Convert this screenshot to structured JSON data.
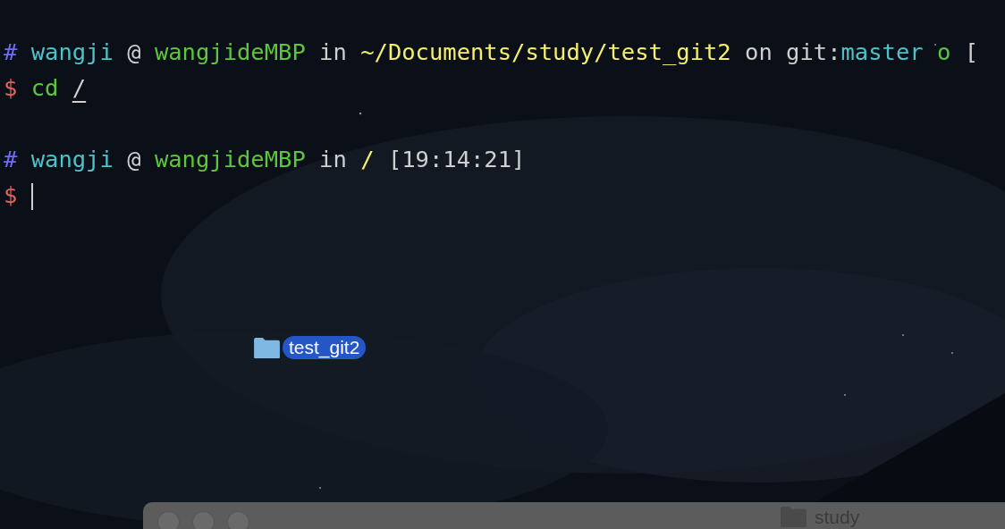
{
  "terminal": {
    "blocks": [
      {
        "prompt": [
          {
            "text": "#",
            "color": "#6f6cff",
            "underlined": false
          },
          {
            "text": "wangji",
            "color": "#4fc1c9",
            "underlined": false
          },
          {
            "text": "@",
            "color": "#cfcfcf",
            "underlined": false
          },
          {
            "text": "wangjideMBP",
            "color": "#5ec63c",
            "underlined": false
          },
          {
            "text": "in",
            "color": "#cfcfcf",
            "underlined": false
          },
          {
            "text": "~/Documents/study/test_git2",
            "color": "#f4ef6c",
            "underlined": false
          },
          {
            "text": "on",
            "color": "#cfcfcf",
            "underlined": false
          },
          {
            "text": "git:",
            "color": "#cfcfcf",
            "underlined": false,
            "joined": true
          },
          {
            "text": "master",
            "color": "#4fc1c9",
            "underlined": false
          },
          {
            "text": "o",
            "color": "#5ec63c",
            "underlined": false
          },
          {
            "text": "[",
            "color": "#cfcfcf",
            "underlined": false
          }
        ],
        "command": [
          {
            "text": "$",
            "color": "#e2625e",
            "underlined": false
          },
          {
            "text": "cd",
            "color": "#5ec63c",
            "underlined": false
          },
          {
            "text": "/",
            "color": "#cfcfcf",
            "underlined": true
          }
        ],
        "cursor": false
      },
      {
        "prompt": [
          {
            "text": "#",
            "color": "#6f6cff",
            "underlined": false
          },
          {
            "text": "wangji",
            "color": "#4fc1c9",
            "underlined": false
          },
          {
            "text": "@",
            "color": "#cfcfcf",
            "underlined": false
          },
          {
            "text": "wangjideMBP",
            "color": "#5ec63c",
            "underlined": false
          },
          {
            "text": "in",
            "color": "#cfcfcf",
            "underlined": false
          },
          {
            "text": "/",
            "color": "#f4ef6c",
            "underlined": false
          },
          {
            "text": "[19:14:21]",
            "color": "#cfcfcf",
            "underlined": false
          }
        ],
        "command": [
          {
            "text": "$",
            "color": "#e2625e",
            "underlined": false
          }
        ],
        "cursor": true
      }
    ]
  },
  "desktop": {
    "icons": [
      {
        "label": "test_git2",
        "selected": true
      }
    ]
  },
  "finder_window": {
    "title": "study"
  }
}
